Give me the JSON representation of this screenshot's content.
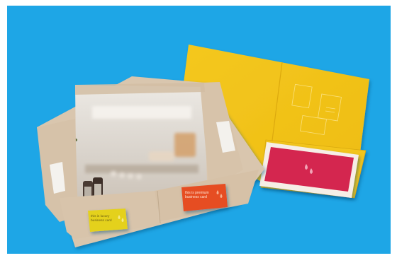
{
  "scene": "presentation folders on blue backdrop",
  "colors": {
    "backdrop": "#1ea6e6",
    "yellow_folder": "#f2c31b",
    "kraft_folder": "#d9c5ad",
    "red_card": "#d4264f",
    "yellow_card": "#e4d11f",
    "orange_card": "#e64d22"
  },
  "yellow_card": {
    "line1": "this is luxury",
    "line2": "business card"
  },
  "orange_card": {
    "line1": "this is premium",
    "line2": "business card"
  }
}
